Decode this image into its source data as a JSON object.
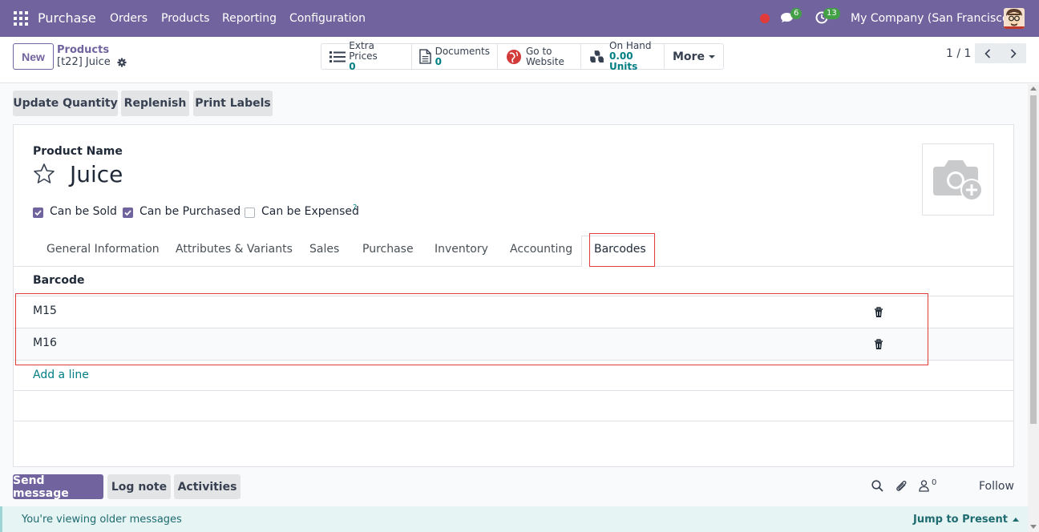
{
  "navbar": {
    "app_name": "Purchase",
    "menu": [
      "Orders",
      "Products",
      "Reporting",
      "Configuration"
    ],
    "messages_count": "6",
    "activities_count": "13",
    "company": "My Company (San Francisco)",
    "bg_color": "#71639e"
  },
  "control": {
    "new_label": "New",
    "breadcrumb_parent": "Products",
    "breadcrumb_current": "[t22] Juice",
    "smart_buttons": [
      {
        "icon": "list-icon",
        "label": "Extra Prices",
        "value": "0"
      },
      {
        "icon": "document-icon",
        "label": "Documents",
        "value": "0"
      },
      {
        "icon": "globe-icon",
        "label": "Go to",
        "value": "Website"
      },
      {
        "icon": "cubes-icon",
        "label": "On Hand",
        "value": "0.00 Units"
      }
    ],
    "more_label": "More",
    "pager": "1 / 1"
  },
  "actions": [
    "Update Quantity",
    "Replenish",
    "Print Labels"
  ],
  "form": {
    "product_name_label": "Product Name",
    "product_name": "Juice",
    "checkboxes": [
      {
        "label": "Can be Sold",
        "checked": true
      },
      {
        "label": "Can be Purchased",
        "checked": true
      },
      {
        "label": "Can be Expensed",
        "checked": false
      }
    ],
    "expensed_help": "?",
    "tabs": [
      "General Information",
      "Attributes & Variants",
      "Sales",
      "Purchase",
      "Inventory",
      "Accounting",
      "Barcodes"
    ],
    "active_tab": "Barcodes",
    "barcode_header": "Barcode",
    "barcodes": [
      "M15",
      "M16"
    ],
    "add_line": "Add a line"
  },
  "chatter": {
    "send_message": "Send message",
    "log_note": "Log note",
    "activities": "Activities",
    "followers_count": "0",
    "follow": "Follow",
    "older_messages": "You're viewing older messages",
    "jump_to_present": "Jump to Present"
  },
  "colors": {
    "accent": "#71639e",
    "link": "#017e84",
    "highlight": "#e03a3a"
  }
}
